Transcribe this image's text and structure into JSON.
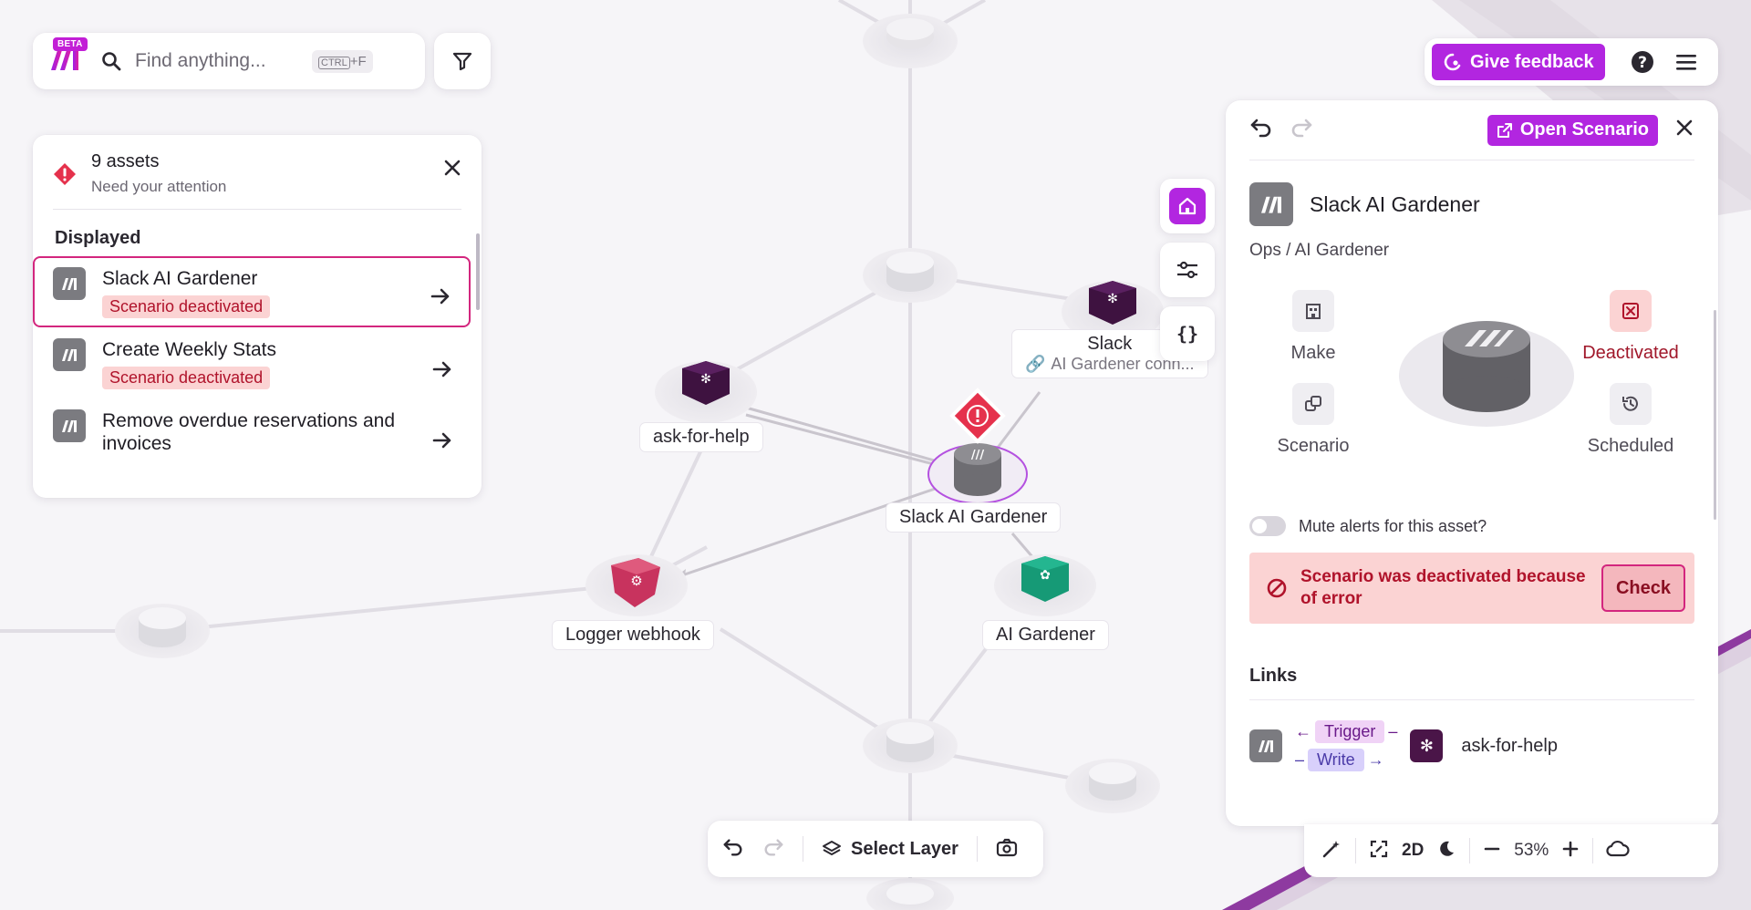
{
  "search": {
    "placeholder": "Find anything...",
    "shortcut_key": "CTRL",
    "shortcut_suffix": "+F",
    "beta_label": "BETA"
  },
  "topbar": {
    "feedback_label": "Give feedback"
  },
  "attention": {
    "count_label": "9 assets",
    "sub_label": "Need your attention",
    "section_label": "Displayed",
    "items": [
      {
        "name": "Slack AI Gardener",
        "badge": "Scenario deactivated"
      },
      {
        "name": "Create Weekly Stats",
        "badge": "Scenario deactivated"
      },
      {
        "name": "Remove overdue reservations and invoices",
        "badge": ""
      }
    ]
  },
  "graph": {
    "nodes": {
      "ask": "ask-for-help",
      "slack": "Slack",
      "slack_conn": "AI Gardener conn...",
      "main": "Slack AI Gardener",
      "logger": "Logger webhook",
      "ai": "AI Gardener"
    }
  },
  "detail": {
    "open_label": "Open Scenario",
    "title": "Slack AI Gardener",
    "breadcrumb": "Ops / AI Gardener",
    "status": {
      "make": "Make",
      "scenario": "Scenario",
      "deactivated": "Deactivated",
      "scheduled": "Scheduled"
    },
    "mute_label": "Mute alerts for this asset?",
    "mute_on": false,
    "alert_text": "Scenario was deactivated because of error",
    "check_label": "Check",
    "links_label": "Links",
    "link_trigger": "Trigger",
    "link_write": "Write",
    "link_target": "ask-for-help"
  },
  "bottom": {
    "select_layer_label": "Select Layer"
  },
  "zoom": {
    "mode": "2D",
    "level": "53%"
  },
  "colors": {
    "accent": "#b226e0",
    "danger": "#b0132b",
    "danger_bg": "#fbd3d3",
    "selection": "#d3267e",
    "slack": "#4a1548",
    "webhook": "#c8335e",
    "openai": "#10a37f"
  }
}
